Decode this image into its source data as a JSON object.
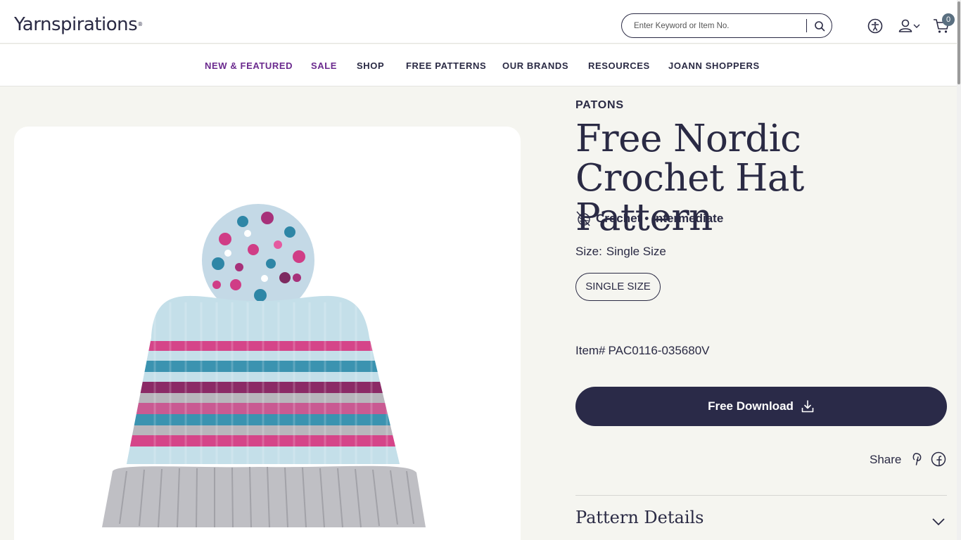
{
  "header": {
    "logo": "Yarnspirations",
    "logo_mark": "®",
    "search_placeholder": "Enter Keyword or Item No.",
    "cart_count": "0",
    "icons": [
      "accessibility-icon",
      "user-icon",
      "chevron-down-icon",
      "cart-icon",
      "search-icon"
    ]
  },
  "nav": {
    "items": [
      "NEW & FEATURED",
      "SALE",
      "SHOP",
      "FREE PATTERNS",
      "OUR BRANDS",
      "RESOURCES",
      "JOANN SHOPPERS"
    ],
    "highlight_color": "#6b2a8e"
  },
  "product": {
    "brand": "PATONS",
    "title": "Free Nordic Crochet Hat Pattern",
    "craft": "Crochet",
    "separator": "•",
    "skill": "Intermediate",
    "size_label": "Size:",
    "size_value": "Single Size",
    "size_option": "SINGLE SIZE",
    "item_label": "Item#",
    "item_number": "PAC0116-035680V",
    "download_label": "Free Download",
    "share_label": "Share",
    "details_label": "Pattern Details",
    "image_subject": "striped knit beanie with pom-pom"
  },
  "colors": {
    "ink": "#2a2a44",
    "button": "#2a2a48",
    "background": "#f5f5f0",
    "accent": "#6b2a8e"
  }
}
